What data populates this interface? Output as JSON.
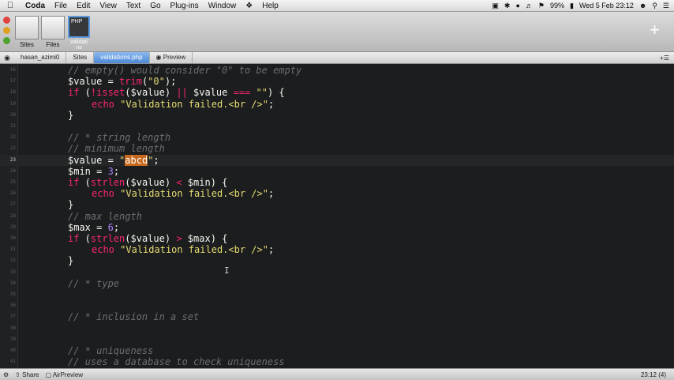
{
  "menubar": {
    "items": [
      "Coda",
      "File",
      "Edit",
      "View",
      "Text",
      "Go",
      "Plug-ins",
      "Window",
      "Help"
    ],
    "battery": "99%",
    "datetime": "Wed 5 Feb  23:12"
  },
  "toolbar": {
    "sites_label": "Sites",
    "files_label": "Files",
    "active_thumb_text": "PHP",
    "active_label": "validati\nns"
  },
  "pathbar": {
    "user": "hasan_azimi0",
    "sites": "Sites",
    "file": "validations.php",
    "preview": "Preview"
  },
  "editor": {
    "current_line": 23,
    "lines": [
      {
        "n": "16",
        "parts": [
          [
            "cm",
            "// empty() would consider \"0\" to be empty"
          ]
        ]
      },
      {
        "n": "17",
        "parts": [
          [
            "var",
            "$value"
          ],
          [
            "",
            " = "
          ],
          [
            "fn",
            "trim"
          ],
          [
            "",
            "("
          ],
          [
            "str",
            "\"0\""
          ],
          [
            "",
            ");"
          ]
        ]
      },
      {
        "n": "18",
        "parts": [
          [
            "kw",
            "if"
          ],
          [
            "",
            " ("
          ],
          [
            "kw",
            "!isset"
          ],
          [
            "",
            "("
          ],
          [
            "var",
            "$value"
          ],
          [
            "",
            ") "
          ],
          [
            "kw",
            "||"
          ],
          [
            "",
            " "
          ],
          [
            "var",
            "$value"
          ],
          [
            "",
            " "
          ],
          [
            "kw",
            "==="
          ],
          [
            "",
            " "
          ],
          [
            "str",
            "\"\""
          ],
          [
            "",
            ") {"
          ]
        ]
      },
      {
        "n": "19",
        "indent": true,
        "parts": [
          [
            "kw",
            "echo"
          ],
          [
            "",
            " "
          ],
          [
            "str",
            "\"Validation failed.<br />\""
          ],
          [
            "",
            ";"
          ]
        ]
      },
      {
        "n": "20",
        "parts": [
          [
            "",
            "}"
          ]
        ]
      },
      {
        "n": "21",
        "parts": []
      },
      {
        "n": "22",
        "parts": [
          [
            "cm",
            "// * string length"
          ]
        ]
      },
      {
        "n": "22",
        "parts": [
          [
            "cm",
            "// minimum length"
          ]
        ]
      },
      {
        "n": "23",
        "parts": [
          [
            "var",
            "$value"
          ],
          [
            "",
            " = "
          ],
          [
            "str",
            "\""
          ],
          [
            "hl",
            "abcd"
          ],
          [
            "str",
            "\""
          ],
          [
            "",
            ";"
          ]
        ]
      },
      {
        "n": "24",
        "parts": [
          [
            "var",
            "$min"
          ],
          [
            "",
            " = "
          ],
          [
            "num",
            "3"
          ],
          [
            "",
            ";"
          ]
        ]
      },
      {
        "n": "25",
        "parts": [
          [
            "kw",
            "if"
          ],
          [
            "",
            " ("
          ],
          [
            "fn",
            "strlen"
          ],
          [
            "",
            "("
          ],
          [
            "var",
            "$value"
          ],
          [
            "",
            ") "
          ],
          [
            "kw",
            "<"
          ],
          [
            "",
            " "
          ],
          [
            "var",
            "$min"
          ],
          [
            "",
            ") {"
          ]
        ]
      },
      {
        "n": "26",
        "indent": true,
        "parts": [
          [
            "kw",
            "echo"
          ],
          [
            "",
            " "
          ],
          [
            "str",
            "\"Validation failed.<br />\""
          ],
          [
            "",
            ";"
          ]
        ]
      },
      {
        "n": "27",
        "parts": [
          [
            "",
            "}"
          ]
        ]
      },
      {
        "n": "28",
        "parts": [
          [
            "cm",
            "// max length"
          ]
        ]
      },
      {
        "n": "29",
        "parts": [
          [
            "var",
            "$max"
          ],
          [
            "",
            " = "
          ],
          [
            "num",
            "6"
          ],
          [
            "",
            ";"
          ]
        ]
      },
      {
        "n": "30",
        "parts": [
          [
            "kw",
            "if"
          ],
          [
            "",
            " ("
          ],
          [
            "fn",
            "strlen"
          ],
          [
            "",
            "("
          ],
          [
            "var",
            "$value"
          ],
          [
            "",
            ") "
          ],
          [
            "kw",
            ">"
          ],
          [
            "",
            " "
          ],
          [
            "var",
            "$max"
          ],
          [
            "",
            ") {"
          ]
        ]
      },
      {
        "n": "31",
        "indent": true,
        "parts": [
          [
            "kw",
            "echo"
          ],
          [
            "",
            " "
          ],
          [
            "str",
            "\"Validation failed.<br />\""
          ],
          [
            "",
            ";"
          ]
        ]
      },
      {
        "n": "32",
        "parts": [
          [
            "",
            "}"
          ]
        ]
      },
      {
        "n": "33",
        "parts": []
      },
      {
        "n": "34",
        "parts": [
          [
            "cm",
            "// * type"
          ]
        ]
      },
      {
        "n": "35",
        "parts": []
      },
      {
        "n": "36",
        "parts": []
      },
      {
        "n": "37",
        "parts": [
          [
            "cm",
            "// * inclusion in a set"
          ]
        ]
      },
      {
        "n": "38",
        "parts": []
      },
      {
        "n": "39",
        "parts": []
      },
      {
        "n": "40",
        "parts": [
          [
            "cm",
            "// * uniqueness"
          ]
        ]
      },
      {
        "n": "41",
        "parts": [
          [
            "cm",
            "// uses a database to check uniqueness"
          ]
        ]
      }
    ]
  },
  "statusbar": {
    "share": "Share",
    "airpreview": "AirPreview",
    "position": "23:12 (4)"
  }
}
